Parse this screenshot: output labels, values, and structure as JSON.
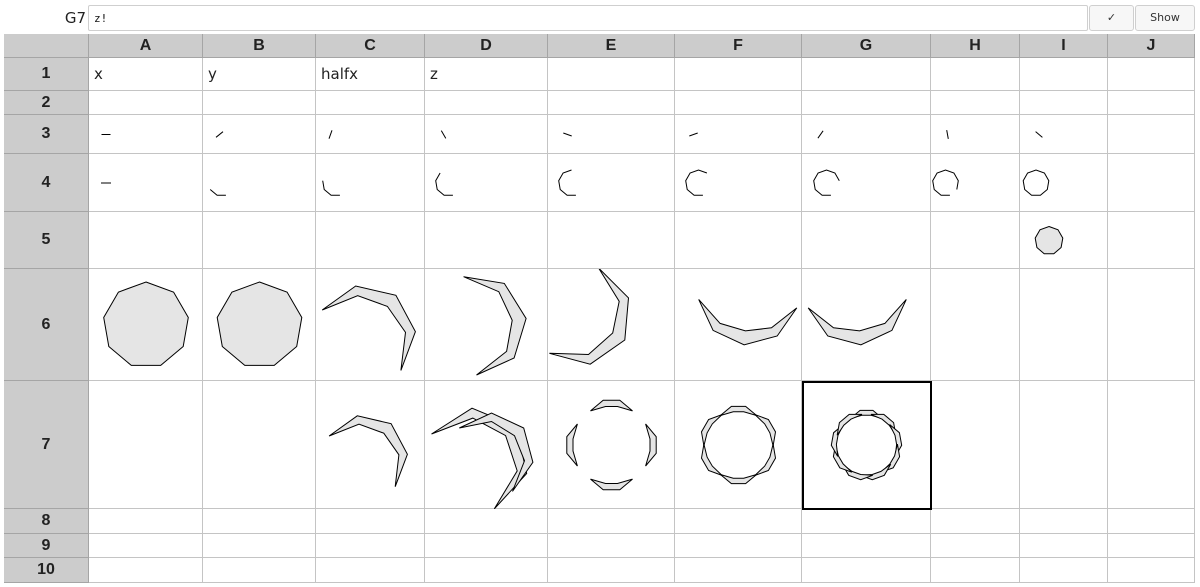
{
  "formula_bar": {
    "cell_ref": "G7",
    "formula": "z!",
    "confirm_label": "✓",
    "show_label": "Show"
  },
  "columns": [
    "A",
    "B",
    "C",
    "D",
    "E",
    "F",
    "G",
    "H",
    "I",
    "J"
  ],
  "rows": [
    "1",
    "2",
    "3",
    "4",
    "5",
    "6",
    "7",
    "8",
    "9",
    "10"
  ],
  "cells": {
    "A1": "x",
    "B1": "y",
    "C1": "halfx",
    "D1": "z"
  },
  "selected_cell": "G7",
  "colors": {
    "header_bg": "#cccccc",
    "shape_fill": "#e5e5e5",
    "shape_stroke": "#000000",
    "grid_line": "#c4c4c4"
  },
  "shapes": {
    "row3": "single stroke segments",
    "row4": "partial nonagon outlines, growing left to right",
    "row5": "small filled nonagon in column I",
    "row6": "filled nonagons (A,B) then curved crescents (C–G)",
    "row7": "crescent, double crescent, and multi-armed pinwheels (C–G)"
  }
}
